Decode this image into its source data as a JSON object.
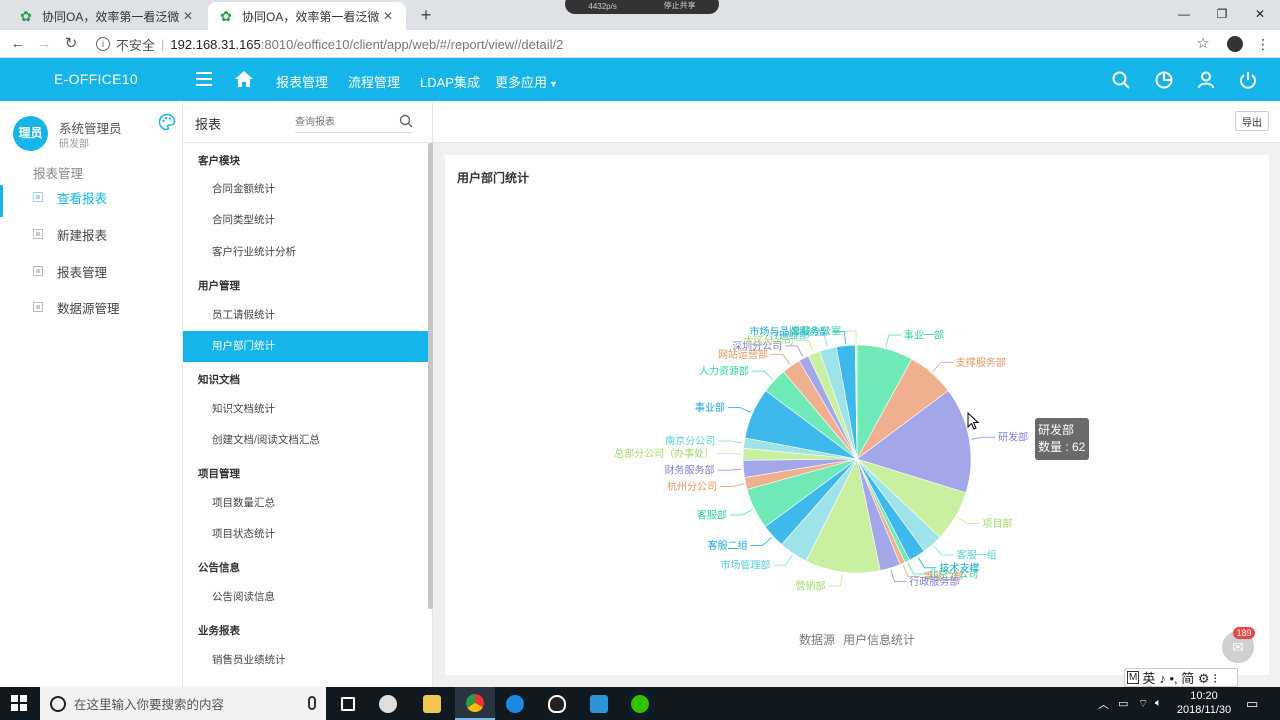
{
  "browser": {
    "tabs": [
      {
        "title": "协同OA，效率第一看泛微",
        "active": false
      },
      {
        "title": "协同OA，效率第一看泛微",
        "active": true
      }
    ],
    "share_pill": {
      "speed": "4432p/s",
      "stop": "停止共享"
    },
    "address": {
      "insecure_label": "不安全",
      "host": "192.168.31.165",
      "path": ":8010/eoffice10/client/app/web/#/report/view//detail/2"
    }
  },
  "header": {
    "brand": "E-OFFICE10",
    "nav": [
      "报表管理",
      "流程管理",
      "LDAP集成",
      "更多应用"
    ]
  },
  "user": {
    "avatar_text": "理员",
    "name": "系统管理员",
    "dept": "研发部"
  },
  "sidebar": {
    "section": "报表管理",
    "items": [
      {
        "label": "查看报表",
        "active": true
      },
      {
        "label": "新建报表",
        "active": false
      },
      {
        "label": "报表管理",
        "active": false
      },
      {
        "label": "数据源管理",
        "active": false
      }
    ]
  },
  "report_list": {
    "title": "报表",
    "search_placeholder": "查询报表",
    "groups": [
      {
        "title": "客户模块",
        "items": [
          "合同金额统计",
          "合同类型统计",
          "客户行业统计分析"
        ]
      },
      {
        "title": "用户管理",
        "items": [
          "员工请假统计",
          "用户部门统计"
        ]
      },
      {
        "title": "知识文档",
        "items": [
          "知识文档统计",
          "创建文档/阅读文档汇总"
        ]
      },
      {
        "title": "项目管理",
        "items": [
          "项目数量汇总",
          "项目状态统计"
        ]
      },
      {
        "title": "公告信息",
        "items": [
          "公告阅读信息"
        ]
      },
      {
        "title": "业务报表",
        "items": [
          "销售员业绩统计"
        ]
      }
    ],
    "active_item": "用户部门统计"
  },
  "main": {
    "export_label": "导出",
    "card_title": "用户部门统计",
    "datasource_label": "数据源",
    "datasource_value": "用户信息统计",
    "tooltip": {
      "name": "研发部",
      "value_line": "数量 : 62"
    }
  },
  "chart_data": {
    "type": "pie",
    "series_name": "数量",
    "slices": [
      {
        "name": "事业一部",
        "value": 33,
        "color": "#6fe9b6"
      },
      {
        "name": "支撑服务部",
        "value": 28,
        "color": "#f0b090"
      },
      {
        "name": "研发部",
        "value": 62,
        "color": "#a3a6e8"
      },
      {
        "name": "项目部",
        "value": 30,
        "color": "#c8f0a0"
      },
      {
        "name": "客服一组",
        "value": 12,
        "color": "#9ee3ea"
      },
      {
        "name": "技术支撑",
        "value": 10,
        "color": "#3fb9ec"
      },
      {
        "name": "北京分公司",
        "value": 3,
        "color": "#6fe9b6"
      },
      {
        "name": "事业二部",
        "value": 3,
        "color": "#f0b090"
      },
      {
        "name": "行政服务部",
        "value": 12,
        "color": "#a3a6e8"
      },
      {
        "name": "营销部",
        "value": 44,
        "color": "#c8f0a0"
      },
      {
        "name": "市场管理部",
        "value": 17,
        "color": "#9ee3ea"
      },
      {
        "name": "客服二组",
        "value": 14,
        "color": "#3fb9ec"
      },
      {
        "name": "客服部",
        "value": 24,
        "color": "#6fe9b6"
      },
      {
        "name": "杭州分公司",
        "value": 7,
        "color": "#f0b090"
      },
      {
        "name": "财务服务部",
        "value": 10,
        "color": "#a3a6e8"
      },
      {
        "name": "总部分公司（办事处）",
        "value": 7,
        "color": "#c8f0a0"
      },
      {
        "name": "南京分公司",
        "value": 6,
        "color": "#9ee3ea"
      },
      {
        "name": "事业部",
        "value": 30,
        "color": "#3fb9ec"
      },
      {
        "name": "人力资源部",
        "value": 15,
        "color": "#6fe9b6"
      },
      {
        "name": "网站运营部",
        "value": 11,
        "color": "#f0b090"
      },
      {
        "name": "深圳分公司",
        "value": 6,
        "color": "#a3a6e8"
      },
      {
        "name": "大区分公司",
        "value": 7,
        "color": "#c8f0a0"
      },
      {
        "name": "IT运维部",
        "value": 10,
        "color": "#9ee3ea"
      },
      {
        "name": "市场与品牌服务部",
        "value": 11,
        "color": "#3fb9ec"
      },
      {
        "name": "总裁办公室",
        "value": 1,
        "color": "#c8f0a0"
      }
    ]
  },
  "ime": {
    "text": "英"
  },
  "chat_badge": "189",
  "taskbar": {
    "search_placeholder": "在这里输入你要搜索的内容",
    "time": "10:20",
    "date": "2018/11/30"
  }
}
